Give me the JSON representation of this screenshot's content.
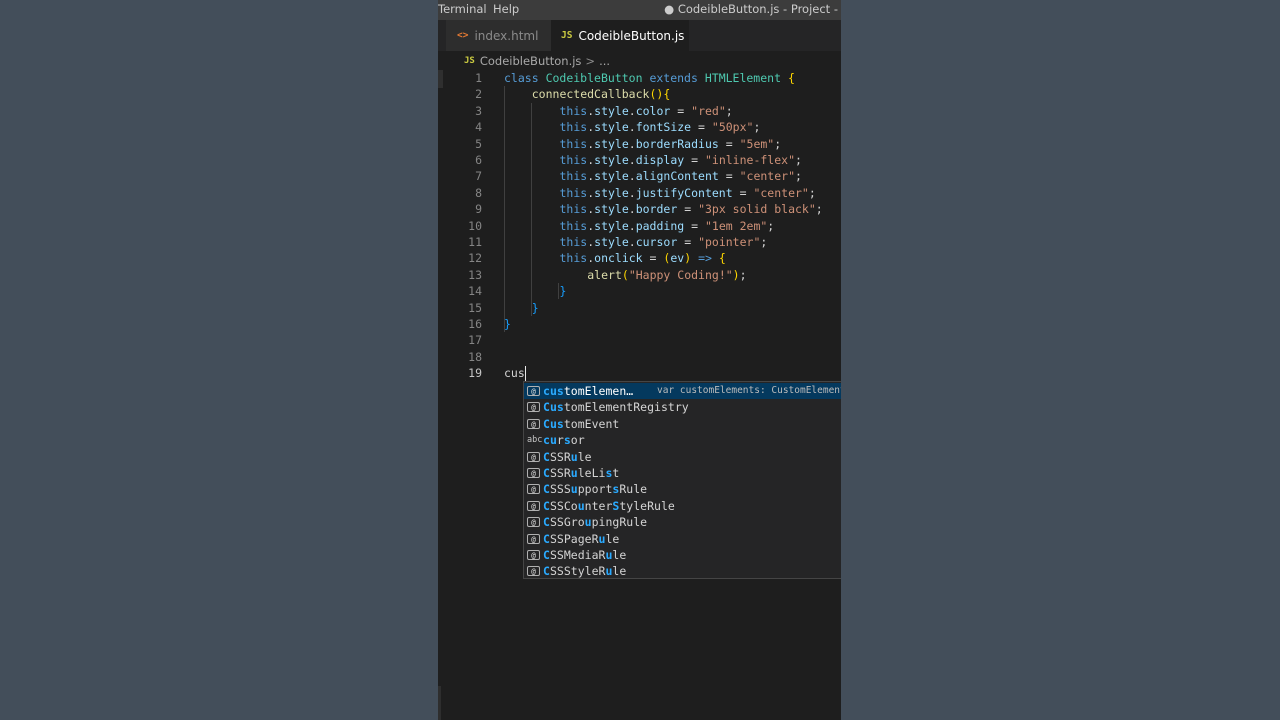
{
  "menubar": {
    "terminal_label": "Terminal",
    "help_label": "Help",
    "window_title": "● CodeibleButton.js - Project -"
  },
  "tabs": {
    "inactive": {
      "icon": "<>",
      "label": "index.html"
    },
    "active": {
      "icon": "JS",
      "label": "CodeibleButton.js"
    }
  },
  "breadcrumb": {
    "icon": "JS",
    "file": "CodeibleButton.js",
    "separator": ">",
    "rest": "..."
  },
  "line_numbers": [
    "1",
    "2",
    "3",
    "4",
    "5",
    "6",
    "7",
    "8",
    "9",
    "10",
    "11",
    "12",
    "13",
    "14",
    "15",
    "16",
    "17",
    "18",
    "19"
  ],
  "code": [
    "class CodeibleButton extends HTMLElement {",
    "    connectedCallback(){",
    "        this.style.color = \"red\";",
    "        this.style.fontSize = \"50px\";",
    "        this.style.borderRadius = \"5em\";",
    "        this.style.display = \"inline-flex\";",
    "        this.style.alignContent = \"center\";",
    "        this.style.justifyContent = \"center\";",
    "        this.style.border = \"3px solid black\";",
    "        this.style.padding = \"1em 2em\";",
    "        this.style.cursor = \"pointer\";",
    "        this.onclick = (ev) => {",
    "            alert(\"Happy Coding!\");",
    "        }",
    "    }",
    "}",
    "",
    "",
    "cus"
  ],
  "current_line": "19",
  "typed_text": "cus",
  "suggestions": [
    {
      "icon": "[@]",
      "kind": "variable",
      "label": "customElemen…",
      "detail": "var customElements: CustomElement"
    },
    {
      "icon": "[@]",
      "kind": "variable",
      "label": "CustomElementRegistry"
    },
    {
      "icon": "[@]",
      "kind": "variable",
      "label": "CustomEvent"
    },
    {
      "icon": "abc",
      "kind": "word",
      "label": "cursor"
    },
    {
      "icon": "[@]",
      "kind": "variable",
      "label": "CSSRule"
    },
    {
      "icon": "[@]",
      "kind": "variable",
      "label": "CSSRuleList"
    },
    {
      "icon": "[@]",
      "kind": "variable",
      "label": "CSSSupportsRule"
    },
    {
      "icon": "[@]",
      "kind": "variable",
      "label": "CSSCounterStyleRule"
    },
    {
      "icon": "[@]",
      "kind": "variable",
      "label": "CSSGroupingRule"
    },
    {
      "icon": "[@]",
      "kind": "variable",
      "label": "CSSPageRule"
    },
    {
      "icon": "[@]",
      "kind": "variable",
      "label": "CSSMediaRule"
    },
    {
      "icon": "[@]",
      "kind": "variable",
      "label": "CSSStyleRule"
    }
  ],
  "colors": {
    "editor_background": "#1e1e1e",
    "page_background": "#434e5a",
    "keyword": "#569cd6",
    "class_name": "#4ec9b0",
    "function": "#dcdcaa",
    "property": "#9cdcfe",
    "string": "#ce9178",
    "match_highlight": "#2aaaff",
    "selection": "#04395e"
  }
}
